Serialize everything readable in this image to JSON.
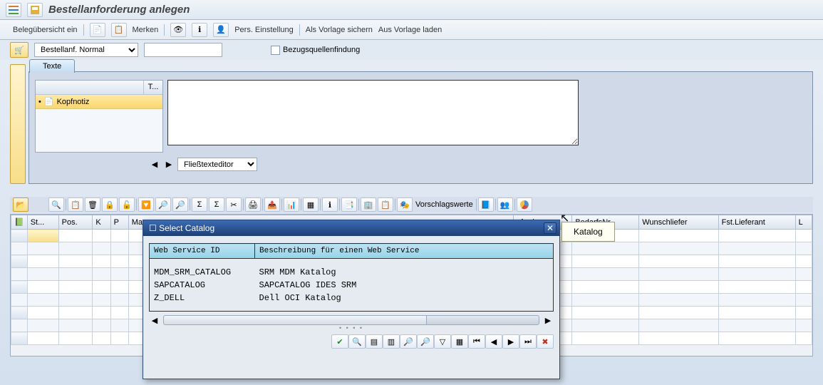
{
  "title": "Bestellanforderung anlegen",
  "toolbar1": {
    "overview": "Belegübersicht ein",
    "merken": "Merken",
    "pers": "Pers. Einstellung",
    "save_template": "Als Vorlage sichern",
    "load_template": "Aus Vorlage laden"
  },
  "doctype": {
    "selected": "Bestellanf. Normal",
    "source_det": "Bezugsquellenfindung"
  },
  "tabs": {
    "texte": "Texte"
  },
  "text_list": {
    "t_col": "T...",
    "kopfnotiz": "Kopfnotiz"
  },
  "editor_select": "Fließtexteditor",
  "item_toolbar": {
    "vorschlag": "Vorschlagswerte"
  },
  "grid_cols": [
    "St...",
    "Pos.",
    "K",
    "P",
    "Ma",
    "",
    "",
    "",
    "",
    "",
    "",
    "",
    "",
    "",
    "nforderer",
    "BedarfsNr.",
    "Wunschliefer",
    "Fst.Lieferant",
    "L"
  ],
  "dialog": {
    "title": "Select Catalog",
    "col1": "Web Service ID",
    "col2": "Beschreibung für einen Web Service",
    "rows": [
      {
        "id": "MDM_SRM_CATALOG",
        "desc": "SRM MDM Katalog"
      },
      {
        "id": "SAPCATALOG",
        "desc": "SAPCATALOG IDES SRM"
      },
      {
        "id": "Z_DELL",
        "desc": "Dell OCI Katalog"
      }
    ]
  },
  "tooltip": "Katalog"
}
